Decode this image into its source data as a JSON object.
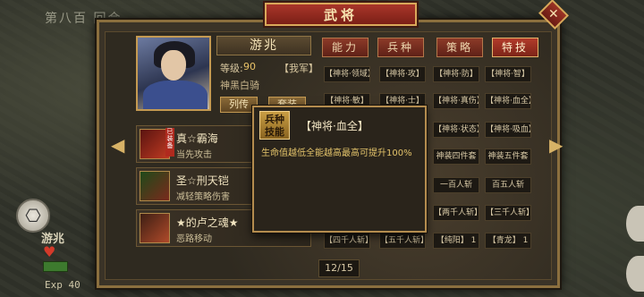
{
  "world": {
    "title": "第八百",
    "title_suffix": "回合",
    "player_name": "游兆",
    "exp_label": "Exp",
    "exp_value": "40",
    "side_icon": "menu-icon"
  },
  "panel": {
    "title": "武将",
    "close_symbol": "✕"
  },
  "hero": {
    "name": "游兆",
    "level_label": "等级:",
    "level_value": "90",
    "faction": "【我军】",
    "title": "神黑白骑",
    "btn_bio": "列传",
    "btn_equip": "套装"
  },
  "tabs": [
    {
      "label": "能力",
      "active": false
    },
    {
      "label": "兵种",
      "active": false
    },
    {
      "label": "策略",
      "active": false
    },
    {
      "label": "特技",
      "active": true
    }
  ],
  "skills": {
    "row1": [
      "【神将·领域】",
      "【神将·攻】",
      "【神将·防】",
      "【神将·智】"
    ],
    "row2": [
      "【神将·敏】",
      "【神将·士】",
      "【神将·真伤】",
      "【神将·血全】"
    ],
    "row3": [
      "【神将·状态】",
      "【神将·吸血】"
    ],
    "row4": [
      "神装四件套",
      "神装五件套"
    ],
    "row5": [
      "一百人斩",
      "百五人斩"
    ],
    "row6": [
      "【两千人斩】",
      "【三千人斩】"
    ],
    "row7": [
      "【四千人斩】",
      "【五千人斩】",
      "【纯阳】 1",
      "【青龙】 1"
    ]
  },
  "equipment": [
    {
      "name": "真☆霸海",
      "desc": "当先攻击",
      "tag": "已装备"
    },
    {
      "name": "圣☆刑天铠",
      "desc": "减轻策略伤害",
      "tag": ""
    },
    {
      "name": "★的卢之魂★",
      "desc": "恶路移动",
      "tag": ""
    }
  ],
  "tooltip": {
    "badge": "兵种技能",
    "badge_line1": "兵种",
    "badge_line2": "技能",
    "title": "【神将·血全】",
    "desc": "生命值越低全能越高最高可提升100%"
  },
  "pagination": {
    "current": "12",
    "total": "15",
    "text": "12/15"
  },
  "colors": {
    "accent_red": "#a9362a",
    "gold_border": "#c49a52",
    "tooltip_desc": "#e3c36a"
  }
}
